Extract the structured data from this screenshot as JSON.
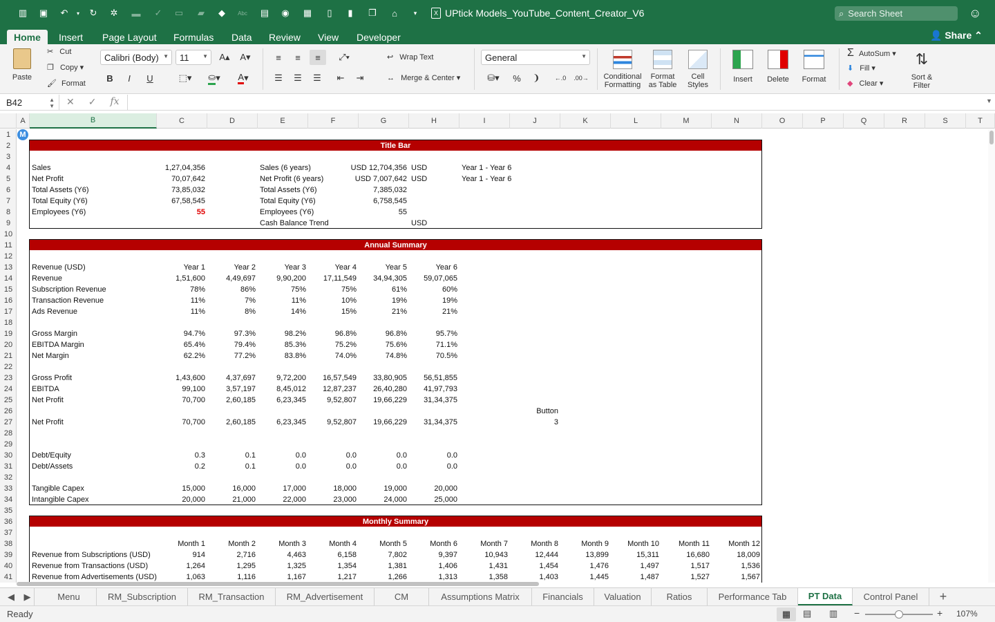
{
  "window": {
    "title": "UPtick Models_YouTube_Content_Creator_V6",
    "search_placeholder": "Search Sheet",
    "share_label": "Share",
    "accent": "#1e7145"
  },
  "ribbon_tabs": [
    "Home",
    "Insert",
    "Page Layout",
    "Formulas",
    "Data",
    "Review",
    "View",
    "Developer"
  ],
  "ribbon": {
    "paste": "Paste",
    "cut": "Cut",
    "copy": "Copy",
    "format_painter": "Format",
    "font_name": "Calibri (Body)",
    "font_size": "11",
    "bold": "B",
    "italic": "I",
    "underline": "U",
    "wrap_text": "Wrap Text",
    "merge_center": "Merge & Center",
    "number_format": "General",
    "percent": "%",
    "conditional_formatting": [
      "Conditional",
      "Formatting"
    ],
    "format_as_table": [
      "Format",
      "as Table"
    ],
    "cell_styles": [
      "Cell",
      "Styles"
    ],
    "insert": "Insert",
    "delete": "Delete",
    "format": "Format",
    "autosum": "AutoSum",
    "fill": "Fill",
    "clear": "Clear",
    "sort_filter": [
      "Sort &",
      "Filter"
    ]
  },
  "formula_bar": {
    "name_box": "B42",
    "fx": "fx",
    "value": ""
  },
  "columns": [
    "A",
    "B",
    "C",
    "D",
    "E",
    "F",
    "G",
    "H",
    "I",
    "J",
    "K",
    "L",
    "M",
    "N",
    "O",
    "P",
    "Q",
    "R",
    "S",
    "T"
  ],
  "selected_column": "B",
  "sections": {
    "title_bar": "Title Bar",
    "annual_summary": "Annual Summary",
    "monthly_summary": "Monthly Summary"
  },
  "overview": {
    "left": [
      {
        "label": "Sales",
        "value": "1,27,04,356"
      },
      {
        "label": "Net Profit",
        "value": "70,07,642"
      },
      {
        "label": "Total Assets (Y6)",
        "value": "73,85,032"
      },
      {
        "label": "Total Equity (Y6)",
        "value": "67,58,545"
      },
      {
        "label": "Employees (Y6)",
        "value": "55"
      }
    ],
    "right": [
      {
        "label": "Sales (6 years)",
        "value": "USD 12,704,356",
        "unit": "USD",
        "period": "Year 1 - Year 6"
      },
      {
        "label": "Net Profit (6 years)",
        "value": "USD 7,007,642",
        "unit": "USD",
        "period": "Year 1 - Year 6"
      },
      {
        "label": "Total Assets (Y6)",
        "value": "7,385,032",
        "unit": "",
        "period": ""
      },
      {
        "label": "Total Equity (Y6)",
        "value": "6,758,545",
        "unit": "",
        "period": ""
      },
      {
        "label": "Employees (Y6)",
        "value": "55",
        "unit": "",
        "period": ""
      },
      {
        "label": "Cash Balance Trend",
        "value": "",
        "unit": "USD",
        "period": ""
      }
    ],
    "employees_highlight_color": "#e00000"
  },
  "annual": {
    "rows": [
      {
        "row": 13,
        "label": "Revenue (USD)",
        "values": [
          "Year 1",
          "Year 2",
          "Year 3",
          "Year 4",
          "Year 5",
          "Year 6"
        ]
      },
      {
        "row": 14,
        "label": "Revenue",
        "values": [
          "1,51,600",
          "4,49,697",
          "9,90,200",
          "17,11,549",
          "34,94,305",
          "59,07,065"
        ]
      },
      {
        "row": 15,
        "label": "Subscription Revenue",
        "values": [
          "78%",
          "86%",
          "75%",
          "75%",
          "61%",
          "60%"
        ]
      },
      {
        "row": 16,
        "label": "Transaction Revenue",
        "values": [
          "11%",
          "7%",
          "11%",
          "10%",
          "19%",
          "19%"
        ]
      },
      {
        "row": 17,
        "label": "Ads Revenue",
        "values": [
          "11%",
          "8%",
          "14%",
          "15%",
          "21%",
          "21%"
        ]
      },
      {
        "row": 19,
        "label": "Gross Margin",
        "values": [
          "94.7%",
          "97.3%",
          "98.2%",
          "96.8%",
          "96.8%",
          "95.7%"
        ]
      },
      {
        "row": 20,
        "label": "EBITDA Margin",
        "values": [
          "65.4%",
          "79.4%",
          "85.3%",
          "75.2%",
          "75.6%",
          "71.1%"
        ]
      },
      {
        "row": 21,
        "label": "Net Margin",
        "values": [
          "62.2%",
          "77.2%",
          "83.8%",
          "74.0%",
          "74.8%",
          "70.5%"
        ]
      },
      {
        "row": 23,
        "label": "Gross Profit",
        "values": [
          "1,43,600",
          "4,37,697",
          "9,72,200",
          "16,57,549",
          "33,80,905",
          "56,51,855"
        ]
      },
      {
        "row": 24,
        "label": "EBITDA",
        "values": [
          "99,100",
          "3,57,197",
          "8,45,012",
          "12,87,237",
          "26,40,280",
          "41,97,793"
        ]
      },
      {
        "row": 25,
        "label": "Net Profit",
        "values": [
          "70,700",
          "2,60,185",
          "6,23,345",
          "9,52,807",
          "19,66,229",
          "31,34,375"
        ]
      },
      {
        "row": 27,
        "label": "Net Profit",
        "values": [
          "70,700",
          "2,60,185",
          "6,23,345",
          "9,52,807",
          "19,66,229",
          "31,34,375"
        ]
      },
      {
        "row": 30,
        "label": "Debt/Equity",
        "values": [
          "0.3",
          "0.1",
          "0.0",
          "0.0",
          "0.0",
          "0.0"
        ]
      },
      {
        "row": 31,
        "label": "Debt/Assets",
        "values": [
          "0.2",
          "0.1",
          "0.0",
          "0.0",
          "0.0",
          "0.0"
        ]
      },
      {
        "row": 33,
        "label": "Tangible Capex",
        "values": [
          "15,000",
          "16,000",
          "17,000",
          "18,000",
          "19,000",
          "20,000"
        ]
      },
      {
        "row": 34,
        "label": "Intangible Capex",
        "values": [
          "20,000",
          "21,000",
          "22,000",
          "23,000",
          "24,000",
          "25,000"
        ]
      }
    ],
    "button_label": "Button",
    "button_value": "3"
  },
  "monthly": {
    "headers": [
      "Month 1",
      "Month 2",
      "Month 3",
      "Month 4",
      "Month 5",
      "Month 6",
      "Month 7",
      "Month 8",
      "Month 9",
      "Month 10",
      "Month 11",
      "Month 12"
    ],
    "rows": [
      {
        "label": "Revenue from Subscriptions (USD)",
        "values": [
          "914",
          "2,716",
          "4,463",
          "6,158",
          "7,802",
          "9,397",
          "10,943",
          "12,444",
          "13,899",
          "15,311",
          "16,680",
          "18,009"
        ]
      },
      {
        "label": "Revenue from Transactions (USD)",
        "values": [
          "1,264",
          "1,295",
          "1,325",
          "1,354",
          "1,381",
          "1,406",
          "1,431",
          "1,454",
          "1,476",
          "1,497",
          "1,517",
          "1,536"
        ]
      },
      {
        "label": "Revenue from Advertisements (USD)",
        "values": [
          "1,063",
          "1,116",
          "1,167",
          "1,217",
          "1,266",
          "1,313",
          "1,358",
          "1,403",
          "1,445",
          "1,487",
          "1,527",
          "1,567"
        ]
      }
    ]
  },
  "header_color": "#b50000",
  "sheet_tabs": [
    "Menu",
    "RM_Subscription",
    "RM_Transaction",
    "RM_Advertisement",
    "CM",
    "Assumptions Matrix",
    "Financials",
    "Valuation",
    "Ratios",
    "Performance Tab",
    "PT Data",
    "Control Panel"
  ],
  "active_sheet": "PT Data",
  "status": {
    "text": "Ready",
    "zoom": "107%"
  }
}
